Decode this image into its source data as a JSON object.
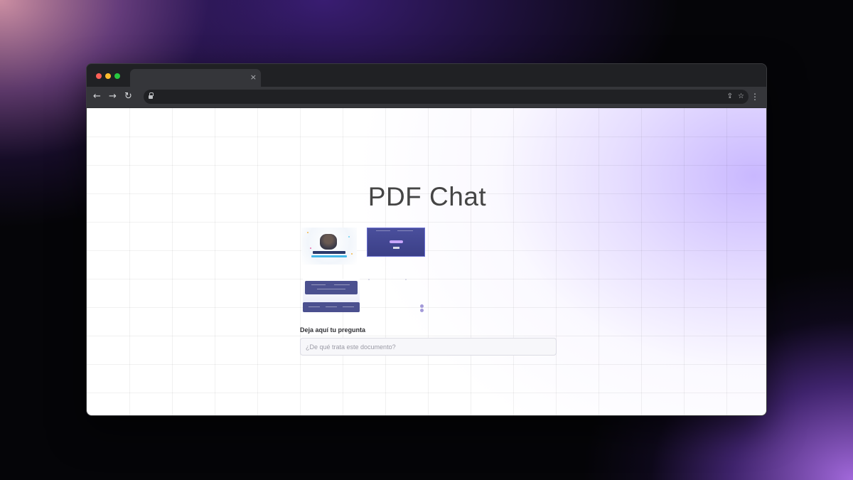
{
  "browser": {
    "tab_close": "×",
    "nav": {
      "back": "←",
      "forward": "→",
      "reload": "↻"
    },
    "omnibox": {
      "share_icon": "share-icon",
      "star_icon": "star-icon"
    },
    "menu": "⋮"
  },
  "page": {
    "title": "PDF Chat",
    "question_label": "Deja aquí tu pregunta",
    "question_placeholder": "¿De qué trata este documento?"
  },
  "colors": {
    "accent": "#c6b4ff",
    "title": "#454545",
    "thumb_dark": "#4a4f9c"
  }
}
